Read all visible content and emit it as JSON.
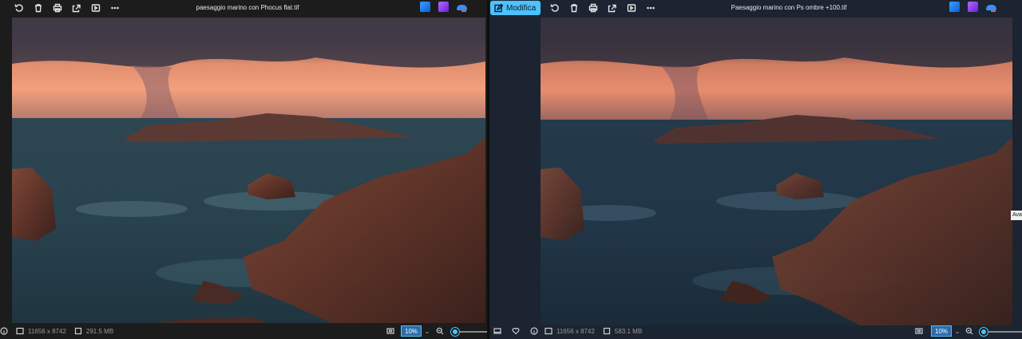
{
  "left": {
    "filename": "paesaggio marino con Phocus flat.tif",
    "dimensions": "11656 x 8742",
    "filesize": "291.5 MB",
    "zoom": "10%",
    "zoom_level": 0.06
  },
  "right": {
    "edit_label": "Modifica",
    "filename": "Paesaggio marino con  Ps ombre +100.tif",
    "dimensions": "11656 x 8742",
    "filesize": "583.1 MB",
    "zoom": "10%",
    "zoom_level": 0.06,
    "tooltip": "Avan"
  },
  "icons": {
    "toolbar": [
      "rotate-icon",
      "delete-icon",
      "print-icon",
      "share-icon",
      "slideshow-icon",
      "more-icon"
    ],
    "apps": [
      "photoshop-icon",
      "clipchamp-icon",
      "onedrive-icon"
    ]
  },
  "colors": {
    "accent": "#4cc2ff",
    "sky_glow": "#f49a78",
    "sea": "#29434f",
    "rock": "#6b3e32"
  }
}
